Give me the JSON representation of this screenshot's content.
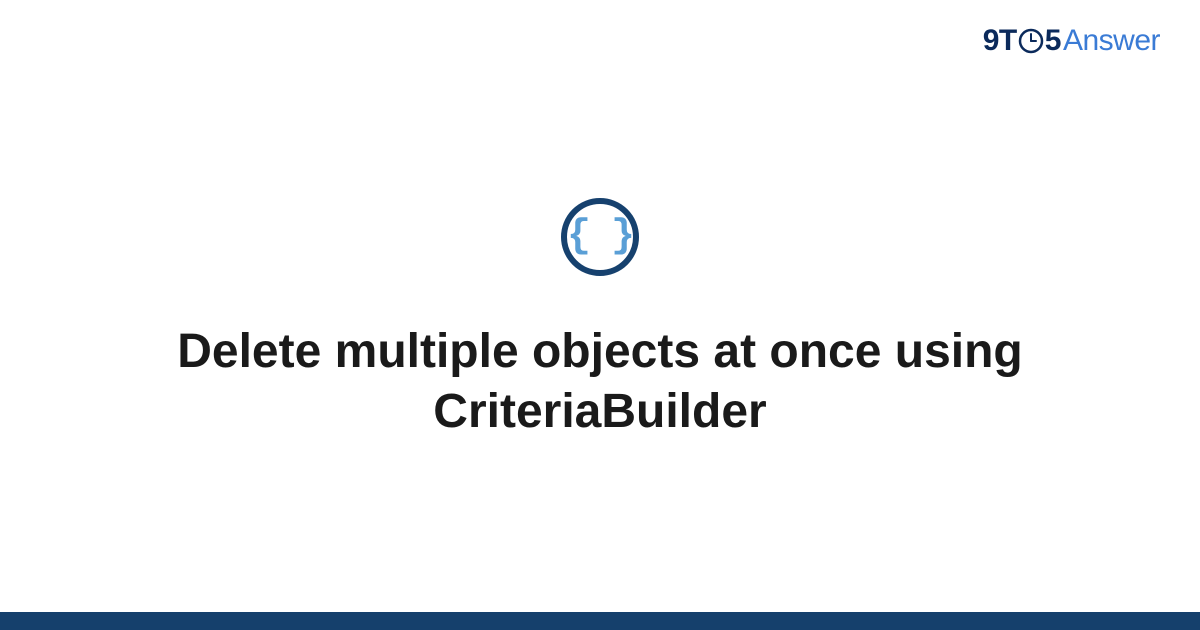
{
  "logo": {
    "prefix": "9T",
    "middle": "5",
    "suffix": "Answer"
  },
  "icon": {
    "name": "code-braces",
    "glyph": "{ }"
  },
  "title": "Delete multiple objects at once using CriteriaBuilder",
  "colors": {
    "darkBlue": "#15406c",
    "lightBlue": "#5a9fd6",
    "logoBlue": "#3a7bd5",
    "logoDark": "#0b2a5b"
  }
}
